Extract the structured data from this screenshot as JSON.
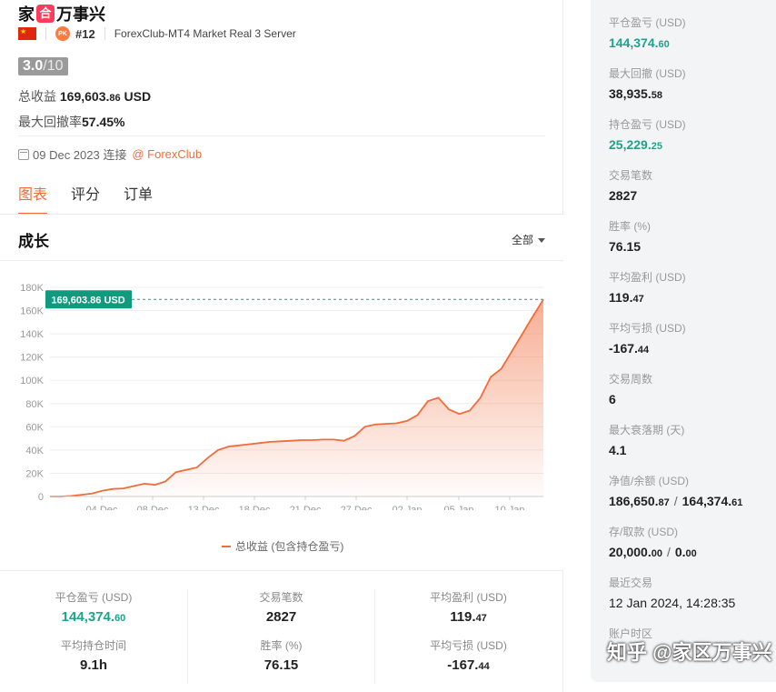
{
  "header": {
    "title_part1": "家",
    "title_badge": "合",
    "title_part2": "万事兴",
    "rank": "#12",
    "server": "ForexClub-MT4 Market Real 3 Server",
    "pk_label": "PK",
    "score": "3.0",
    "score_max": "/10",
    "total_profit_label": "总收益",
    "total_profit_main": "169,603.",
    "total_profit_dec": "86",
    "total_profit_unit": "USD",
    "max_drawdown_label": "最大回撤率",
    "max_drawdown_value": "57.45%",
    "connect_date": "09 Dec 2023 连接",
    "broker_link": "@ ForexClub"
  },
  "tabs": [
    {
      "label": "图表",
      "active": true
    },
    {
      "label": "评分",
      "active": false
    },
    {
      "label": "订单",
      "active": false
    }
  ],
  "chart_section": {
    "title": "成长",
    "range_label": "全部",
    "legend_label": "总收益 (包含持仓盈亏)",
    "current_tag": "169,603.86 USD"
  },
  "chart_data": {
    "type": "area",
    "x_labels": [
      "04 Dec",
      "08 Dec",
      "13 Dec",
      "18 Dec",
      "21 Dec",
      "27 Dec",
      "02 Jan",
      "05 Jan",
      "10 Jan"
    ],
    "y_ticks": [
      "0",
      "20K",
      "40K",
      "60K",
      "80K",
      "100K",
      "120K",
      "140K",
      "160K",
      "180K"
    ],
    "ylim": [
      0,
      180000
    ],
    "series": [
      {
        "values": [
          0,
          0,
          500,
          1500,
          2500,
          5000,
          6500,
          7000,
          9000,
          11000,
          10000,
          13000,
          21000,
          23000,
          25000,
          33000,
          40000,
          43000,
          44000,
          45000,
          46000,
          47000,
          47500,
          48000,
          48500,
          48500,
          49000,
          49000,
          48000,
          52000,
          60000,
          62000,
          62500,
          63000,
          65000,
          70000,
          82000,
          85000,
          75000,
          71000,
          74000,
          85000,
          103000,
          110000,
          125000,
          140000,
          155000,
          169603.86
        ]
      }
    ],
    "grid": true,
    "colors": {
      "line": "#f26b3a",
      "fill": "#f26b3a",
      "tag": "#129a7f",
      "dash": "#1aa58a"
    }
  },
  "stats": [
    {
      "label": "平仓盈亏 (USD)",
      "main": "144,374.",
      "dec": "60",
      "green": true
    },
    {
      "label": "交易笔数",
      "main": "2827",
      "dec": "",
      "green": false
    },
    {
      "label": "平均盈利 (USD)",
      "main": "119.",
      "dec": "47",
      "green": false
    },
    {
      "label": "平均持仓时间",
      "main": "9.1h",
      "dec": "",
      "green": false
    },
    {
      "label": "胜率 (%)",
      "main": "76.15",
      "dec": "",
      "green": false
    },
    {
      "label": "平均亏损 (USD)",
      "main": "-167.",
      "dec": "44",
      "green": false
    }
  ],
  "sidebar": [
    {
      "label": "平仓盈亏 (USD)",
      "main": "144,374.",
      "dec": "60",
      "green": true
    },
    {
      "label": "最大回撤 (USD)",
      "main": "38,935.",
      "dec": "58",
      "green": false
    },
    {
      "label": "持仓盈亏 (USD)",
      "main": "25,229.",
      "dec": "25",
      "green": true
    },
    {
      "label": "交易笔数",
      "main": "2827",
      "dec": "",
      "green": false
    },
    {
      "label": "胜率 (%)",
      "main": "76.15",
      "dec": "",
      "green": false
    },
    {
      "label": "平均盈利 (USD)",
      "main": "119.",
      "dec": "47",
      "green": false
    },
    {
      "label": "平均亏损 (USD)",
      "main": "-167.",
      "dec": "44",
      "green": false
    },
    {
      "label": "交易周数",
      "main": "6",
      "dec": "",
      "green": false
    },
    {
      "label": "最大衰落期 (天)",
      "main": "4.1",
      "dec": "",
      "green": false
    },
    {
      "label": "净值/余额 (USD)",
      "main": "186,650.",
      "dec": "87",
      "sep": "/",
      "main2": "164,374.",
      "dec2": "61",
      "green": false
    },
    {
      "label": "存/取款 (USD)",
      "main": "20,000.",
      "dec": "00",
      "sep": "/",
      "main2": "0.",
      "dec2": "00",
      "green": false
    },
    {
      "label": "最近交易",
      "main": "12 Jan 2024, 14:28:35",
      "dec": "",
      "green": false
    },
    {
      "label": "账户时区",
      "main": "",
      "dec": "",
      "green": false
    }
  ],
  "watermark": "知乎 @家区万事兴"
}
